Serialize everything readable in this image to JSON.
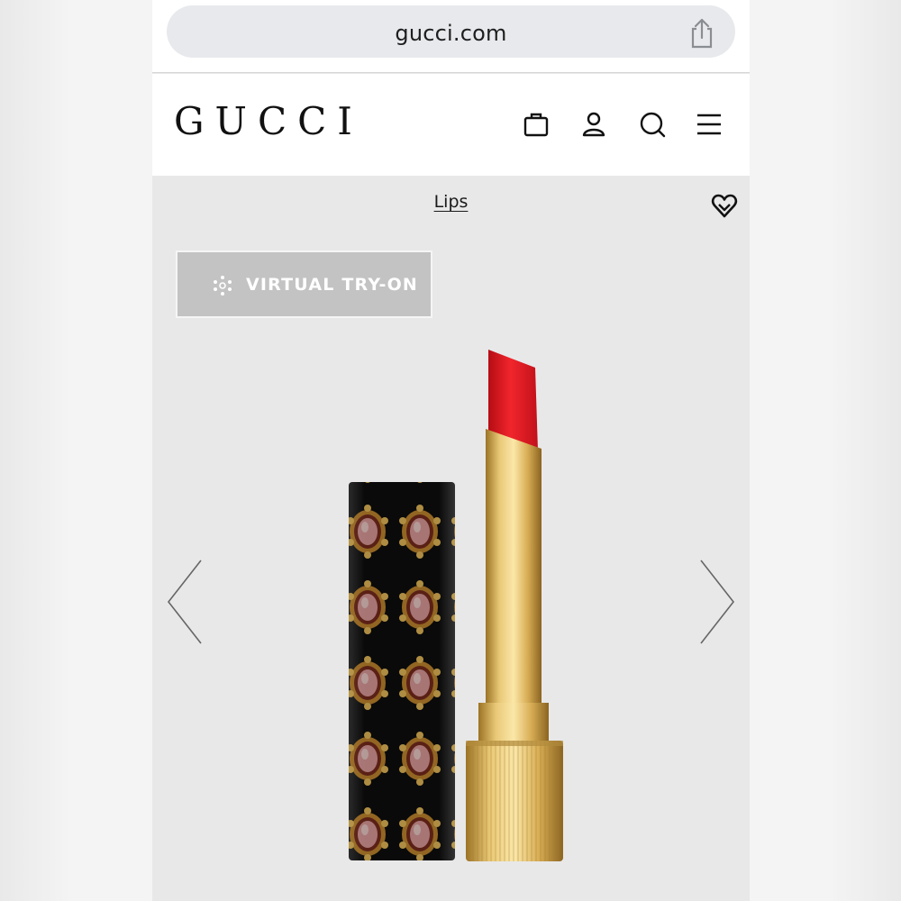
{
  "browser": {
    "url": "gucci.com",
    "share_icon": "share-icon"
  },
  "header": {
    "logo": "GUCCI",
    "icons": [
      "shopping-bag-icon",
      "account-icon",
      "search-icon",
      "menu-icon"
    ]
  },
  "product_page": {
    "category": "Lips",
    "wishlist_icon": "heart-icon",
    "virtual_try_on_label": "VIRTUAL TRY-ON",
    "virtual_try_on_icon": "face-scan-icon",
    "prev_icon": "chevron-left-icon",
    "next_icon": "chevron-right-icon",
    "product_image": "red-lipstick-image",
    "colors": {
      "lipstick": "#e3121b",
      "gold": "#d4a84a",
      "case": "#111111"
    }
  }
}
